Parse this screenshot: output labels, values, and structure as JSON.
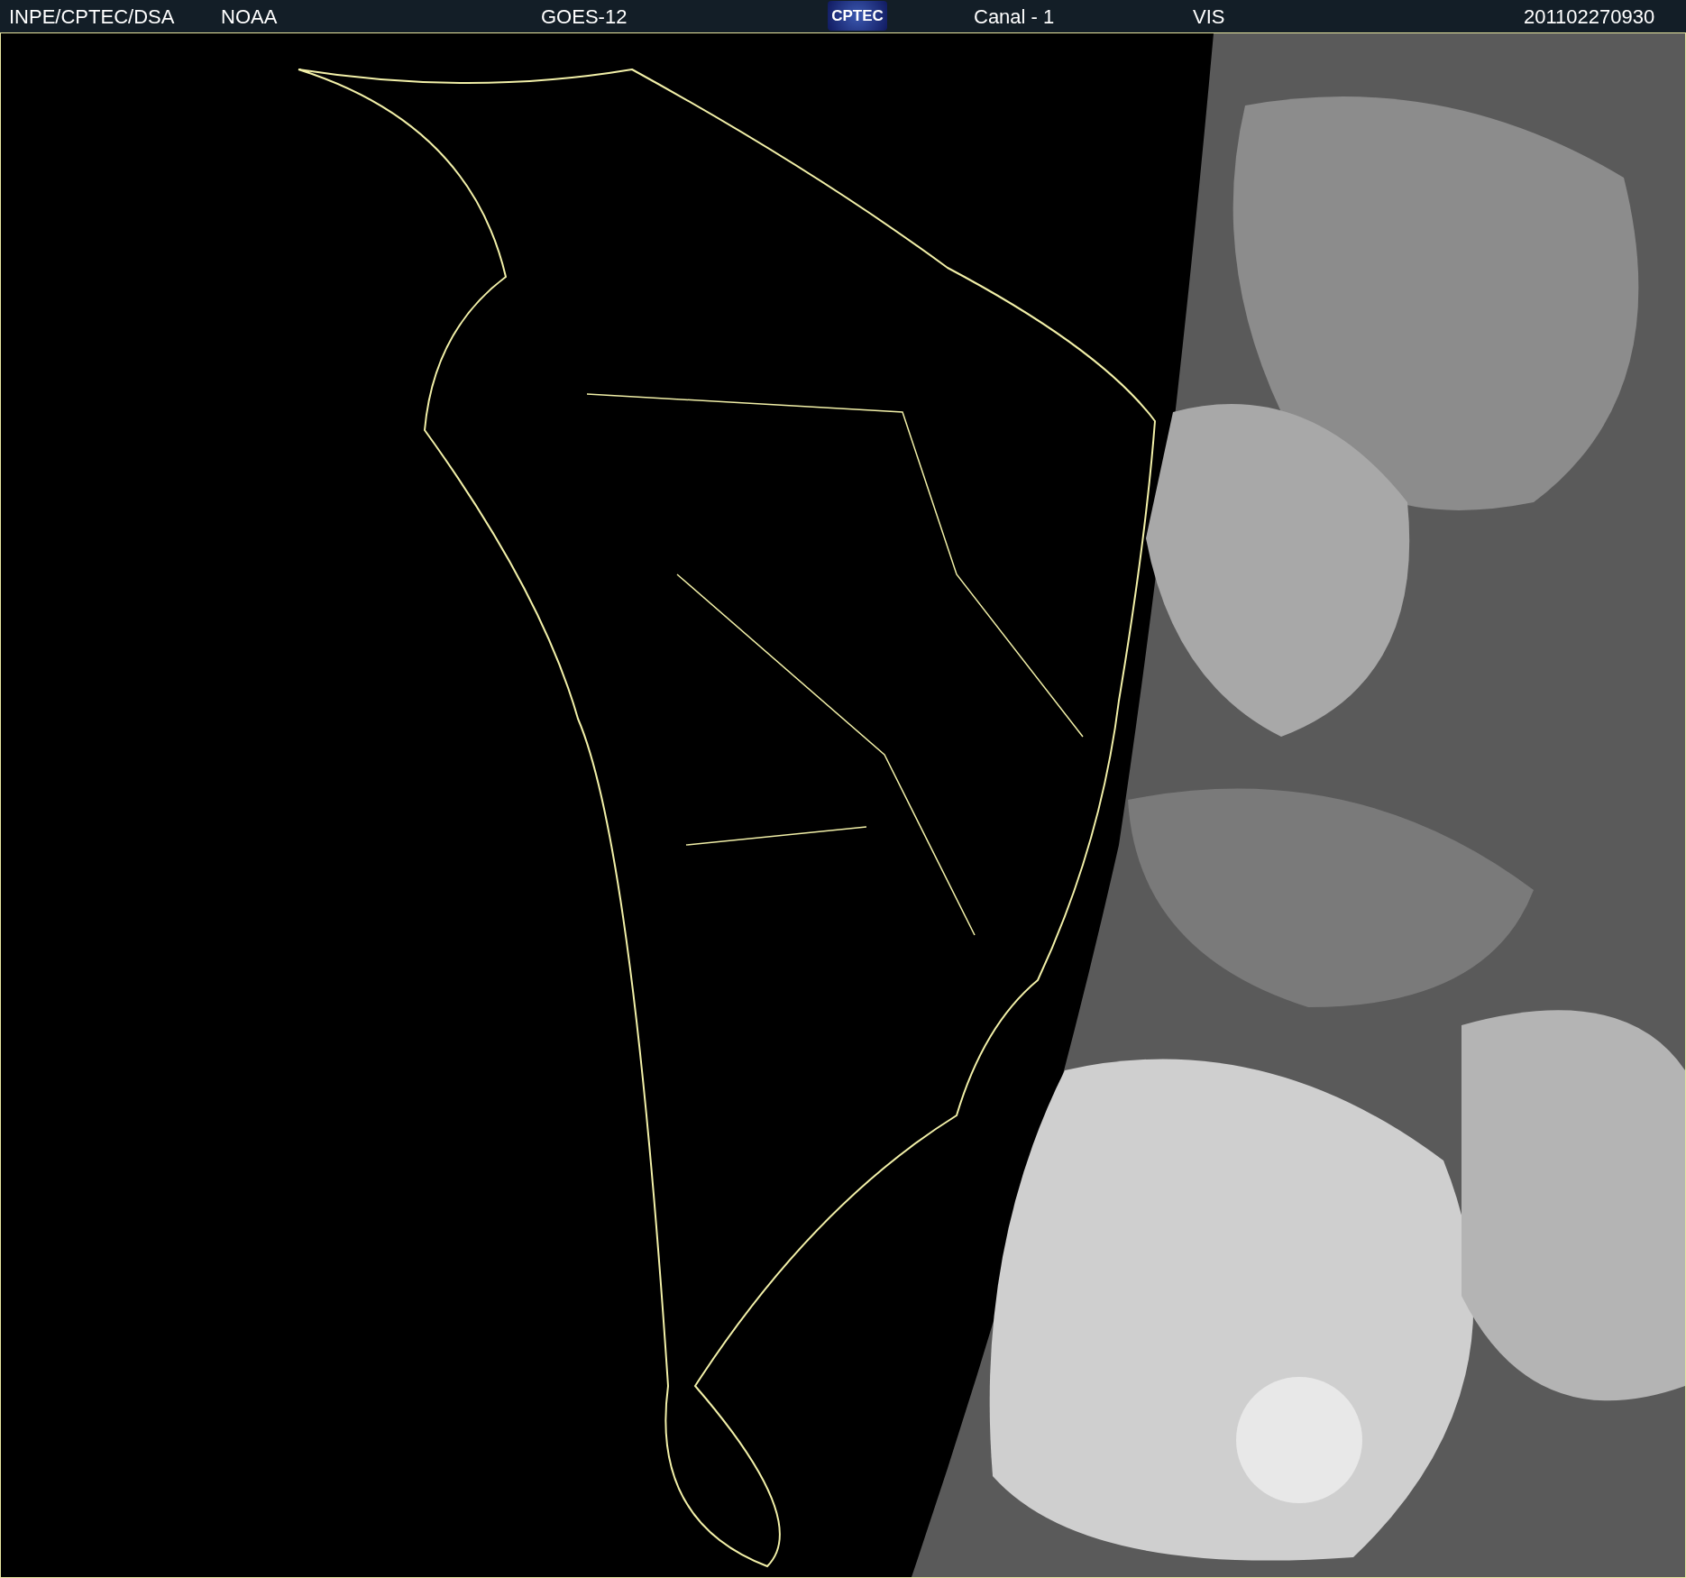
{
  "header": {
    "fields": [
      {
        "kind": "text",
        "text": "INPE/CPTEC/DSA"
      },
      {
        "kind": "text",
        "text": "NOAA"
      },
      {
        "kind": "text",
        "text": "GOES-12"
      },
      {
        "kind": "logo",
        "text": "CPTEC"
      },
      {
        "kind": "text",
        "text": "Canal - 1"
      },
      {
        "kind": "text",
        "text": "VIS"
      },
      {
        "kind": "text",
        "text": "201102270930"
      }
    ]
  }
}
